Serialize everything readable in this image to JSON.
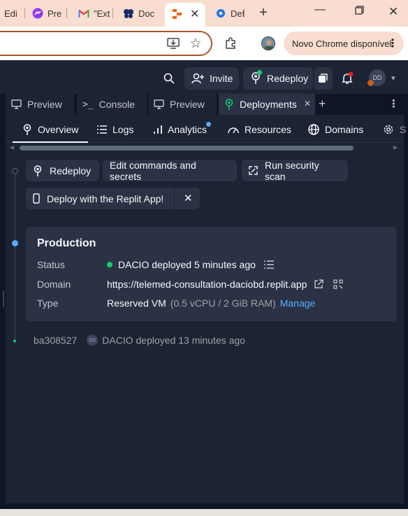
{
  "browser": {
    "tabs": [
      {
        "label": "Edi",
        "icon": "doc-icon"
      },
      {
        "label": "Pre",
        "icon": "messenger-icon"
      },
      {
        "label": "\"Ext",
        "icon": "gmail-icon"
      },
      {
        "label": "Doc",
        "icon": "butterfly-icon"
      },
      {
        "label": "",
        "icon": "replit-icon"
      },
      {
        "label": "Def",
        "icon": "settings-icon"
      }
    ],
    "update_label": "Novo Chrome disponível"
  },
  "header": {
    "invite_label": "Invite",
    "redeploy_label": "Redeploy",
    "avatar_initials": "DD"
  },
  "pane_tabs": [
    {
      "label": "Preview",
      "icon": "monitor-icon"
    },
    {
      "label": "Console",
      "icon": "terminal-icon"
    },
    {
      "label": "Preview",
      "icon": "monitor-icon"
    },
    {
      "label": "Deployments",
      "icon": "deployments-icon",
      "active": true
    }
  ],
  "subnav": [
    {
      "label": "Overview"
    },
    {
      "label": "Logs"
    },
    {
      "label": "Analytics"
    },
    {
      "label": "Resources"
    },
    {
      "label": "Domains"
    },
    {
      "label": "S"
    }
  ],
  "actions": {
    "redeploy": "Redeploy",
    "edit": "Edit commands and secrets",
    "scan": "Run security scan",
    "app_promo": "Deploy with the Replit App!"
  },
  "production": {
    "title": "Production",
    "status_label": "Status",
    "status_value": "DACIO deployed 5 minutes ago",
    "domain_label": "Domain",
    "domain_value": "https://telemed-consultation-daciobd.replit.app",
    "type_label": "Type",
    "type_value": "Reserved VM",
    "type_spec": "(0.5 vCPU / 2 GiB RAM)",
    "manage_label": "Manage"
  },
  "history": [
    {
      "commit": "ba308527",
      "avatar": "DD",
      "text": "DACIO deployed 13 minutes ago"
    }
  ],
  "colors": {
    "accent_link": "#57abff",
    "status_green": "#0cce6b",
    "notify_red": "#e52222"
  }
}
